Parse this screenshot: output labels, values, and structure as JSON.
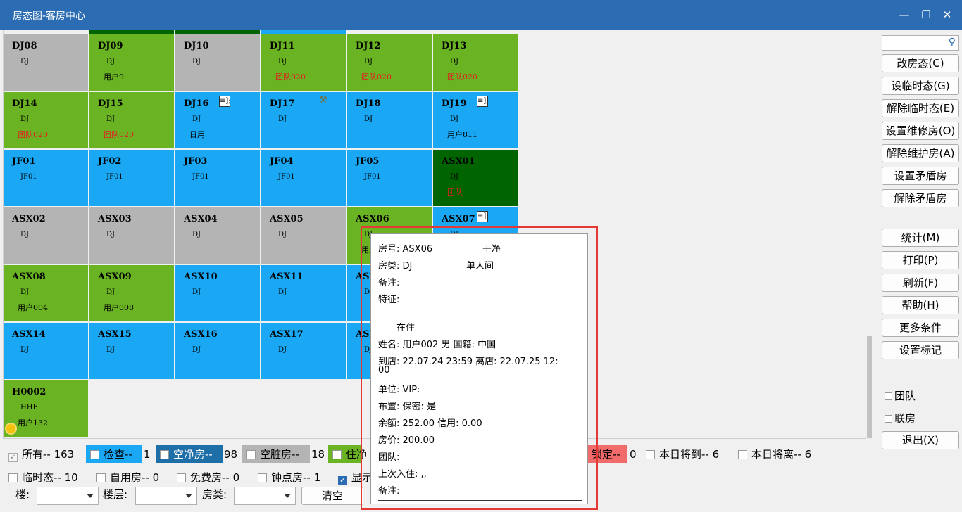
{
  "window": {
    "title": "房态图-客房中心",
    "min_icon": "minimize-icon",
    "max_icon": "restore-icon",
    "close_icon": "close-icon"
  },
  "rooms": [
    {
      "no": "DJ08",
      "type": "DJ",
      "user": "",
      "color": "#b4b4b4",
      "red": false
    },
    {
      "no": "DJ09",
      "type": "DJ",
      "user": "用户9",
      "color": "#6ab424",
      "red": false
    },
    {
      "no": "DJ10",
      "type": "DJ",
      "user": "",
      "color": "#b4b4b4",
      "red": false
    },
    {
      "no": "DJ11",
      "type": "DJ",
      "user": "团队020",
      "color": "#6ab424",
      "red": true
    },
    {
      "no": "DJ12",
      "type": "DJ",
      "user": "团队020",
      "color": "#6ab424",
      "red": true
    },
    {
      "no": "DJ13",
      "type": "DJ",
      "user": "团队020",
      "color": "#6ab424",
      "red": true
    },
    {
      "no": "DJ14",
      "type": "DJ",
      "user": "团队020",
      "color": "#6ab424",
      "red": true
    },
    {
      "no": "DJ15",
      "type": "DJ",
      "user": "团队020",
      "color": "#6ab424",
      "red": true
    },
    {
      "no": "DJ16",
      "type": "DJ",
      "user": "日用",
      "color": "#1aa8f4",
      "red": false,
      "icon": "lock"
    },
    {
      "no": "DJ17",
      "type": "DJ",
      "user": "",
      "color": "#1aa8f4",
      "red": false,
      "icon": "repair"
    },
    {
      "no": "DJ18",
      "type": "DJ",
      "user": "",
      "color": "#1aa8f4",
      "red": false
    },
    {
      "no": "DJ19",
      "type": "DJ",
      "user": "用户811",
      "color": "#1aa8f4",
      "red": false,
      "icon": "lock"
    },
    {
      "no": "JF01",
      "type": "JF01",
      "user": "",
      "color": "#1aa8f4",
      "red": false
    },
    {
      "no": "JF02",
      "type": "JF01",
      "user": "",
      "color": "#1aa8f4",
      "red": false
    },
    {
      "no": "JF03",
      "type": "JF01",
      "user": "",
      "color": "#1aa8f4",
      "red": false
    },
    {
      "no": "JF04",
      "type": "JF01",
      "user": "",
      "color": "#1aa8f4",
      "red": false
    },
    {
      "no": "JF05",
      "type": "JF01",
      "user": "",
      "color": "#1aa8f4",
      "red": false
    },
    {
      "no": "ASX01",
      "type": "DJ",
      "user": "团队",
      "color": "#006400",
      "red": true
    },
    {
      "no": "ASX02",
      "type": "DJ",
      "user": "",
      "color": "#b4b4b4",
      "red": false
    },
    {
      "no": "ASX03",
      "type": "DJ",
      "user": "",
      "color": "#b4b4b4",
      "red": false
    },
    {
      "no": "ASX04",
      "type": "DJ",
      "user": "",
      "color": "#b4b4b4",
      "red": false
    },
    {
      "no": "ASX05",
      "type": "DJ",
      "user": "",
      "color": "#b4b4b4",
      "red": false
    },
    {
      "no": "ASX06",
      "type": "DJ",
      "user": "用户",
      "color": "#6ab424",
      "red": false
    },
    {
      "no": "ASX07",
      "type": "DJ",
      "user": "",
      "color": "#1aa8f4",
      "red": false,
      "icon": "lock"
    },
    {
      "no": "ASX08",
      "type": "DJ",
      "user": "用户004",
      "color": "#6ab424",
      "red": false
    },
    {
      "no": "ASX09",
      "type": "DJ",
      "user": "用户008",
      "color": "#6ab424",
      "red": false
    },
    {
      "no": "ASX10",
      "type": "DJ",
      "user": "",
      "color": "#1aa8f4",
      "red": false
    },
    {
      "no": "ASX11",
      "type": "DJ",
      "user": "",
      "color": "#1aa8f4",
      "red": false
    },
    {
      "no": "ASX",
      "type": "DJ",
      "user": "",
      "color": "#1aa8f4",
      "red": false
    },
    {
      "no": "",
      "type": "",
      "user": "",
      "color": "#1aa8f4",
      "red": false
    },
    {
      "no": "ASX14",
      "type": "DJ",
      "user": "",
      "color": "#1aa8f4",
      "red": false
    },
    {
      "no": "ASX15",
      "type": "DJ",
      "user": "",
      "color": "#1aa8f4",
      "red": false
    },
    {
      "no": "ASX16",
      "type": "DJ",
      "user": "",
      "color": "#1aa8f4",
      "red": false
    },
    {
      "no": "ASX17",
      "type": "DJ",
      "user": "",
      "color": "#1aa8f4",
      "red": false
    },
    {
      "no": "ASX",
      "type": "DJ",
      "user": "",
      "color": "#1aa8f4",
      "red": false
    },
    {
      "no": "",
      "type": "",
      "user": "",
      "color": "#1aa8f4",
      "red": false
    },
    {
      "no": "H0002",
      "type": "HHF",
      "user": "用户132",
      "color": "#6ab424",
      "red": false,
      "icon": "sun"
    }
  ],
  "toolbar": {
    "search_icon": "search-icon",
    "buttons": [
      "改房态(C)",
      "设临时态(G)",
      "解除临时态(E)",
      "设置维修房(O)",
      "解除维护房(A)",
      "设置矛盾房",
      "解除矛盾房"
    ],
    "buttons2": [
      "统计(M)",
      "打印(P)",
      "刷新(F)",
      "帮助(H)",
      "更多条件",
      "设置标记"
    ],
    "chk_team": "团队",
    "chk_link": "联房",
    "exit": "退出(X)"
  },
  "legend": {
    "all": "所有-- 163",
    "check": "检查--",
    "check_n": "1",
    "vc": "空净房--",
    "vc_n": "98",
    "vd": "空脏房--",
    "vd_n": "18",
    "occ": "住净",
    "lock": "锁定--",
    "lock_n": "0",
    "arrive": "本日将到-- 6",
    "leave": "本日将离-- 6",
    "temp": "临时态-- 10",
    "self": "自用房-- 0",
    "free": "免费房-- 0",
    "hour": "钟点房-- 1",
    "show": "显示"
  },
  "filter": {
    "building": "楼:",
    "floor": "楼层:",
    "roomtype": "房类:",
    "clear": "清空"
  },
  "popup": {
    "room": "房号: ASX06",
    "status": "干净",
    "rtype": "房类: DJ",
    "rtype_name": "单人间",
    "note": "备注:",
    "feature": "特征:",
    "section": "——在住——",
    "guest": "姓名: 用户002 男  国籍: 中国",
    "dates1": "到店: 22.07.24 23:59   离店: 22.07.25 12:",
    "dates2": "00",
    "unit": "单位:    VIP:",
    "layout": "布置:    保密: 是",
    "balance": "余额: 252.00   信用: 0.00",
    "price": "房价: 200.00",
    "team": "团队:",
    "last": "上次入住: ,,",
    "note2": "备注:"
  }
}
